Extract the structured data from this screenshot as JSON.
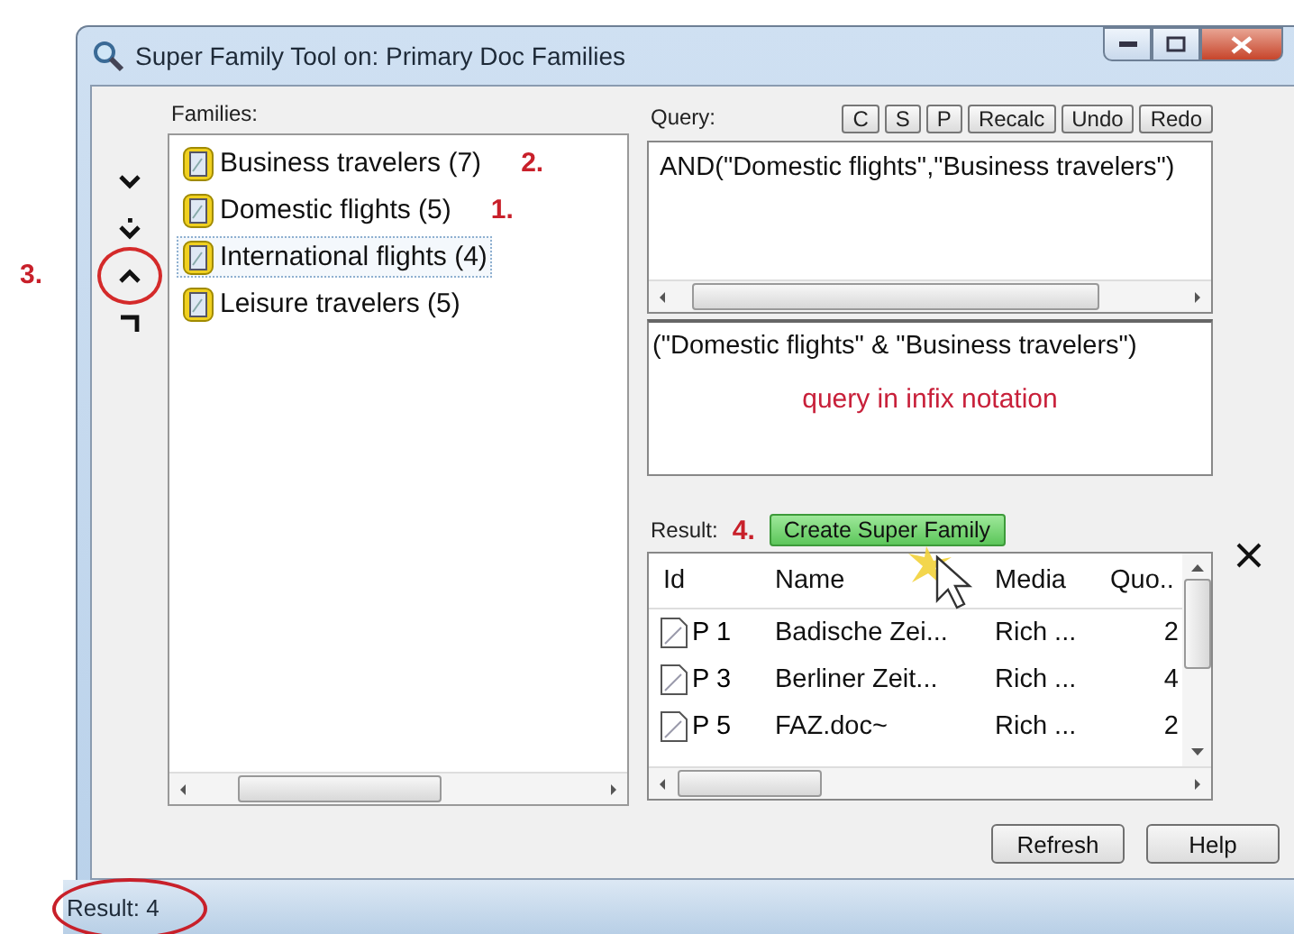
{
  "window": {
    "title": "Super Family Tool on: Primary Doc Families"
  },
  "move_buttons": [
    {
      "kind": "down",
      "circled": false
    },
    {
      "kind": "down_dot",
      "circled": false
    },
    {
      "kind": "up",
      "circled": true,
      "annotation": "3."
    },
    {
      "kind": "corner",
      "circled": false
    }
  ],
  "families": {
    "label": "Families:",
    "items": [
      {
        "name": "Business travelers (7)",
        "selected": false,
        "annotation": "2."
      },
      {
        "name": "Domestic flights (5)",
        "selected": false,
        "annotation": "1."
      },
      {
        "name": "International flights (4)",
        "selected": true
      },
      {
        "name": "Leisure travelers (5)",
        "selected": false
      }
    ]
  },
  "query": {
    "label": "Query:",
    "buttons": [
      "C",
      "S",
      "P",
      "Recalc",
      "Undo",
      "Redo"
    ],
    "text": "AND(\"Domestic flights\",\"Business travelers\")"
  },
  "infix": {
    "text": "(\"Domestic flights\" & \"Business travelers\")",
    "note": "query in infix notation"
  },
  "result": {
    "label": "Result:",
    "annotation": "4.",
    "create_button": "Create Super Family",
    "columns": [
      "Id",
      "Name",
      "Media",
      "Quo.."
    ],
    "rows": [
      [
        "P 1",
        "Badische Zei...",
        "Rich ...",
        "2"
      ],
      [
        "P 3",
        "Berliner Zeit...",
        "Rich ...",
        "4"
      ],
      [
        "P 5",
        "FAZ.doc~",
        "Rich ...",
        "2"
      ]
    ]
  },
  "buttons": [
    "Refresh",
    "Help"
  ],
  "status_bar": {
    "text": "Result: 4",
    "circled": true
  }
}
